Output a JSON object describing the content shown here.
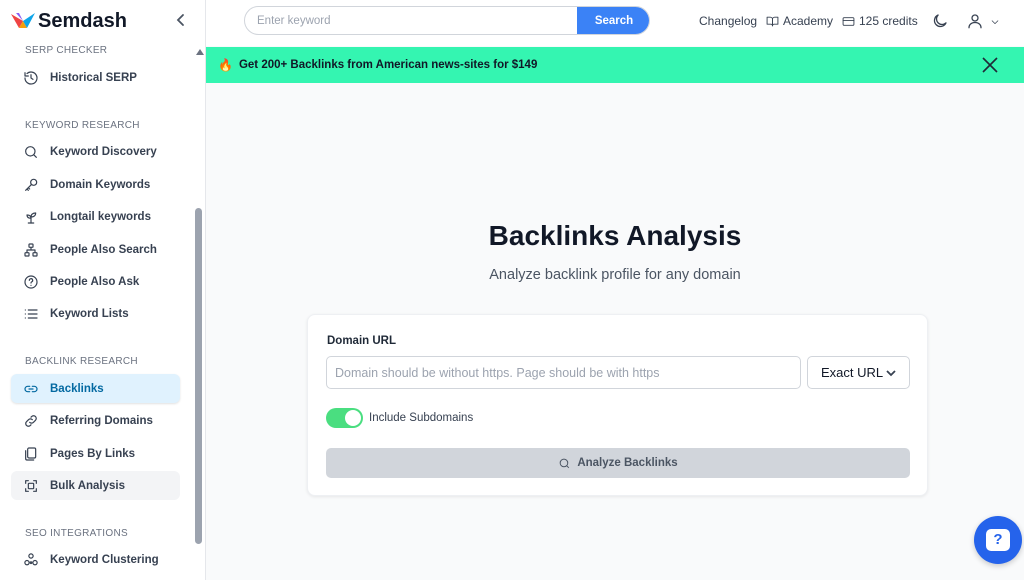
{
  "brand": {
    "name": "Semdash"
  },
  "search": {
    "placeholder": "Enter keyword",
    "button": "Search"
  },
  "topnav": {
    "changelog": "Changelog",
    "academy": "Academy",
    "credits": "125 credits"
  },
  "banner": {
    "text": "Get 200+ Backlinks from American news-sites for $149"
  },
  "sidebar": {
    "sections": {
      "serp_checker": "SERP CHECKER",
      "keyword_research": "KEYWORD RESEARCH",
      "backlink_research": "BACKLINK RESEARCH",
      "seo_integrations": "SEO INTEGRATIONS"
    },
    "items": {
      "historical_serp": "Historical SERP",
      "keyword_discovery": "Keyword Discovery",
      "domain_keywords": "Domain Keywords",
      "longtail_keywords": "Longtail keywords",
      "people_also_search": "People Also Search",
      "people_also_ask": "People Also Ask",
      "keyword_lists": "Keyword Lists",
      "backlinks": "Backlinks",
      "referring_domains": "Referring Domains",
      "pages_by_links": "Pages By Links",
      "bulk_analysis": "Bulk Analysis",
      "keyword_clustering": "Keyword Clustering"
    }
  },
  "main": {
    "title": "Backlinks Analysis",
    "subtitle": "Analyze backlink profile for any domain",
    "domain_label": "Domain URL",
    "domain_placeholder": "Domain should be without https. Page should be with https",
    "mode": "Exact URL",
    "include_subdomains": "Include Subdomains",
    "include_subdomains_on": true,
    "analyze_button": "Analyze Backlinks"
  },
  "help": {
    "glyph": "?"
  },
  "colors": {
    "accent": "#3b82f6",
    "banner": "#34f5b1",
    "active_nav": "#e0f2fe",
    "toggle": "#4ade80"
  }
}
